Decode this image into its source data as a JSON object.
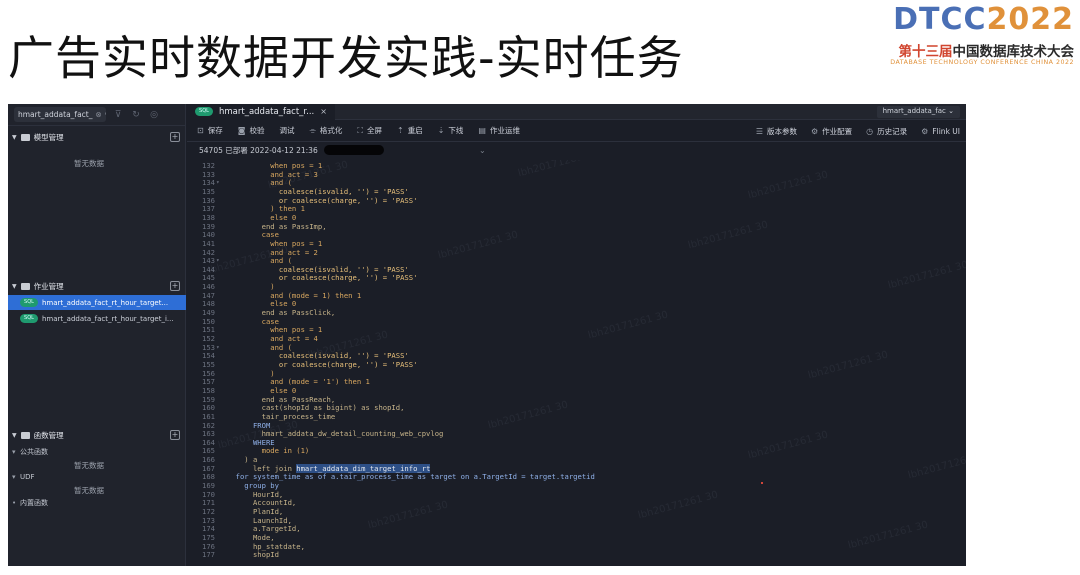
{
  "slide": {
    "title": "广告实时数据开发实践-实时任务",
    "brand": {
      "logo_part1": "DTCC",
      "logo_part2": "2022",
      "cn_1": "第十三届",
      "cn_2": "中国数据库技术大会",
      "en": "DATABASE TECHNOLOGY CONFERENCE CHINA 2022"
    }
  },
  "sidebar": {
    "search_value": "hmart_addata_fact_",
    "sections": [
      {
        "label": "模型管理",
        "empty": "暂无数据"
      },
      {
        "label": "作业管理"
      },
      {
        "label": "函数管理"
      }
    ],
    "jobs": [
      {
        "label": "hmart_addata_fact_rt_hour_target...",
        "pill": "SQL",
        "active": true
      },
      {
        "label": "hmart_addata_fact_rt_hour_target_i...",
        "pill": "SQL",
        "active": false
      }
    ],
    "functions": [
      {
        "label": "公共函数",
        "empty": "暂无数据"
      },
      {
        "label": "UDF",
        "empty": "暂无数据"
      },
      {
        "label": "内置函数"
      }
    ]
  },
  "tab": {
    "pill": "SQL",
    "label": "hmart_addata_fact_r...",
    "close": "×",
    "right_label": "hmart_addata_fac"
  },
  "toolbar": {
    "items": [
      "保存",
      "校验",
      "调试",
      "格式化",
      "全屏",
      "重启",
      "下线",
      "作业运维"
    ],
    "right_items": [
      "版本参数",
      "作业配置",
      "历史记录",
      "Flink UI"
    ]
  },
  "status": {
    "text": "54705  已部署  2022-04-12 21:36"
  },
  "watermark": "lbh20171261 30",
  "code": [
    {
      "n": "132",
      "t": "          when pos = 1",
      "c": "#d9a860"
    },
    {
      "n": "133",
      "t": "          and act = 3",
      "c": "#d9a860"
    },
    {
      "n": "134",
      "f": "▾",
      "t": "          and (",
      "c": "#d9a860"
    },
    {
      "n": "135",
      "t": "            coalesce(isvalid, '') = 'PASS'",
      "c": "#e8c07a"
    },
    {
      "n": "136",
      "t": "            or coalesce(charge, '') = 'PASS'",
      "c": "#e8c07a"
    },
    {
      "n": "137",
      "t": "          ) then 1",
      "c": "#d9a860"
    },
    {
      "n": "138",
      "t": "          else 0",
      "c": "#d9a860"
    },
    {
      "n": "139",
      "t": "        end as PassImp,",
      "c": "#c7b48a"
    },
    {
      "n": "140",
      "t": "        case",
      "c": "#d9a860"
    },
    {
      "n": "141",
      "t": "          when pos = 1",
      "c": "#d9a860"
    },
    {
      "n": "142",
      "t": "          and act = 2",
      "c": "#d9a860"
    },
    {
      "n": "143",
      "f": "▾",
      "t": "          and (",
      "c": "#d9a860"
    },
    {
      "n": "144",
      "t": "            coalesce(isvalid, '') = 'PASS'",
      "c": "#e8c07a"
    },
    {
      "n": "145",
      "t": "            or coalesce(charge, '') = 'PASS'",
      "c": "#e8c07a"
    },
    {
      "n": "146",
      "t": "          )",
      "c": "#d9a860"
    },
    {
      "n": "147",
      "t": "          and (mode = 1) then 1",
      "c": "#d9a860"
    },
    {
      "n": "148",
      "t": "          else 0",
      "c": "#d9a860"
    },
    {
      "n": "149",
      "t": "        end as PassClick,",
      "c": "#c7b48a"
    },
    {
      "n": "150",
      "t": "        case",
      "c": "#d9a860"
    },
    {
      "n": "151",
      "t": "          when pos = 1",
      "c": "#d9a860"
    },
    {
      "n": "152",
      "t": "          and act = 4",
      "c": "#d9a860"
    },
    {
      "n": "153",
      "f": "▾",
      "t": "          and (",
      "c": "#d9a860"
    },
    {
      "n": "154",
      "t": "            coalesce(isvalid, '') = 'PASS'",
      "c": "#e8c07a"
    },
    {
      "n": "155",
      "t": "            or coalesce(charge, '') = 'PASS'",
      "c": "#e8c07a"
    },
    {
      "n": "156",
      "t": "          )",
      "c": "#d9a860"
    },
    {
      "n": "157",
      "t": "          and (mode = '1') then 1",
      "c": "#d9a860"
    },
    {
      "n": "158",
      "t": "          else 0",
      "c": "#d9a860"
    },
    {
      "n": "159",
      "t": "        end as PassReach,",
      "c": "#c7b48a"
    },
    {
      "n": "160",
      "t": "        cast(shopId as bigint) as shopId,",
      "c": "#c7b48a"
    },
    {
      "n": "161",
      "t": "        tair_process_time",
      "c": "#c7b48a"
    },
    {
      "n": "162",
      "t": "      FROM",
      "c": "#8fb0e8"
    },
    {
      "n": "163",
      "t": "        hmart_addata_dw_detail_counting_web_cpvlog",
      "c": "#c7b48a"
    },
    {
      "n": "164",
      "t": "      WHERE",
      "c": "#8fb0e8"
    },
    {
      "n": "165",
      "t": "        mode in (1)",
      "c": "#d9a860"
    },
    {
      "n": "166",
      "t": "    ) a",
      "c": "#c7b48a"
    },
    {
      "n": "167",
      "t": "      left join ",
      "c": "#c7b48a",
      "sel": "hmart_addata_dim_target_info_rt"
    },
    {
      "n": "168",
      "t": "  for system_time as of a.tair_process_time as target on a.TargetId = target.targetid",
      "c": "#8fb0e8"
    },
    {
      "n": "169",
      "t": "    group by",
      "c": "#8fb0e8"
    },
    {
      "n": "170",
      "t": "      HourId,",
      "c": "#c7b48a"
    },
    {
      "n": "171",
      "t": "      AccountId,",
      "c": "#c7b48a"
    },
    {
      "n": "172",
      "t": "      PlanId,",
      "c": "#c7b48a"
    },
    {
      "n": "173",
      "t": "      LaunchId,",
      "c": "#c7b48a"
    },
    {
      "n": "174",
      "t": "      a.TargetId,",
      "c": "#c7b48a"
    },
    {
      "n": "175",
      "t": "      Mode,",
      "c": "#c7b48a"
    },
    {
      "n": "176",
      "t": "      hp_statdate,",
      "c": "#c7b48a"
    },
    {
      "n": "177",
      "t": "      shopId",
      "c": "#c7b48a"
    }
  ]
}
